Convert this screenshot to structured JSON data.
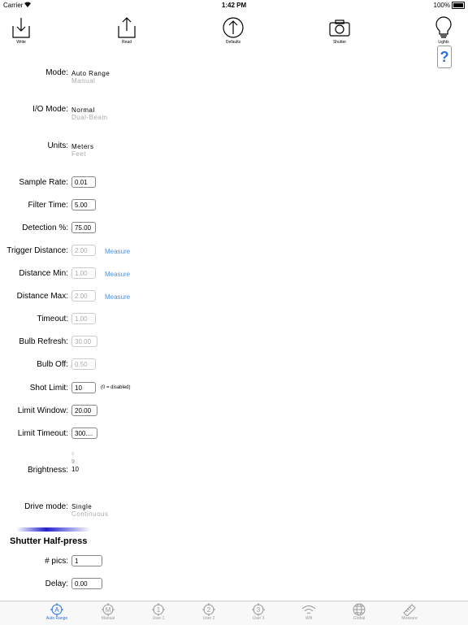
{
  "status": {
    "carrier": "Carrier",
    "time": "1:42 PM",
    "battery": "100%"
  },
  "toolbar": [
    {
      "label": "Write",
      "icon": "download-icon"
    },
    {
      "label": "Read",
      "icon": "upload-icon"
    },
    {
      "label": "Defaults",
      "icon": "up-arrow-circle-icon"
    },
    {
      "label": "Shutter",
      "icon": "camera-icon"
    },
    {
      "label": "Lights",
      "icon": "lightbulb-icon"
    }
  ],
  "help_label": "?",
  "mode": {
    "label": "Mode:",
    "options": [
      "Auto Range",
      "Manual"
    ],
    "selected": "Auto Range"
  },
  "io_mode": {
    "label": "I/O Mode:",
    "options": [
      "Normal",
      "Dual-Beam"
    ],
    "selected": "Normal"
  },
  "units": {
    "label": "Units:",
    "options": [
      "Meters",
      "Feet"
    ],
    "selected": "Meters"
  },
  "fields": {
    "sample_rate": {
      "label": "Sample Rate:",
      "value": "0.01"
    },
    "filter_time": {
      "label": "Filter Time:",
      "value": "5.00"
    },
    "detection": {
      "label": "Detection %:",
      "value": "75.00"
    },
    "trigger_distance": {
      "label": "Trigger Distance:",
      "value": "2.00",
      "action": "Measure"
    },
    "distance_min": {
      "label": "Distance Min:",
      "value": "1.00",
      "action": "Measure"
    },
    "distance_max": {
      "label": "Distance Max:",
      "value": "2.00",
      "action": "Measure"
    },
    "timeout": {
      "label": "Timeout:",
      "value": "1.00"
    },
    "bulb_refresh": {
      "label": "Bulb Refresh:",
      "value": "30.00"
    },
    "bulb_off": {
      "label": "Bulb Off:",
      "value": "0.50"
    },
    "shot_limit": {
      "label": "Shot Limit:",
      "value": "10",
      "note": "(0 = disabled)"
    },
    "limit_window": {
      "label": "Limit Window:",
      "value": "20.00"
    },
    "limit_timeout": {
      "label": "Limit Timeout:",
      "value": "300...."
    }
  },
  "brightness": {
    "label": "Brightness:",
    "options": [
      "8",
      "9",
      "10"
    ],
    "selected": "10"
  },
  "drive_mode": {
    "label": "Drive mode:",
    "options": [
      "Single",
      "Continuous"
    ],
    "selected": "Single"
  },
  "shutter_half_press": {
    "title": "Shutter Half-press",
    "pics": {
      "label": "# pics:",
      "value": "1"
    },
    "delay": {
      "label": "Delay:",
      "value": "0.00"
    }
  },
  "tabs": [
    {
      "label": "Auto Range",
      "glyph": "A",
      "active": true
    },
    {
      "label": "Manual",
      "glyph": "M",
      "active": false
    },
    {
      "label": "User 1",
      "glyph": "1",
      "active": false
    },
    {
      "label": "User 2",
      "glyph": "2",
      "active": false
    },
    {
      "label": "User 3",
      "glyph": "3",
      "active": false
    },
    {
      "label": "Wifi",
      "glyph": "",
      "active": false
    },
    {
      "label": "Global",
      "glyph": "",
      "active": false
    },
    {
      "label": "Measure",
      "glyph": "",
      "active": false
    }
  ],
  "colors": {
    "accent": "#2a70e0",
    "link": "#4a90e2",
    "progress": "#2222cc"
  }
}
